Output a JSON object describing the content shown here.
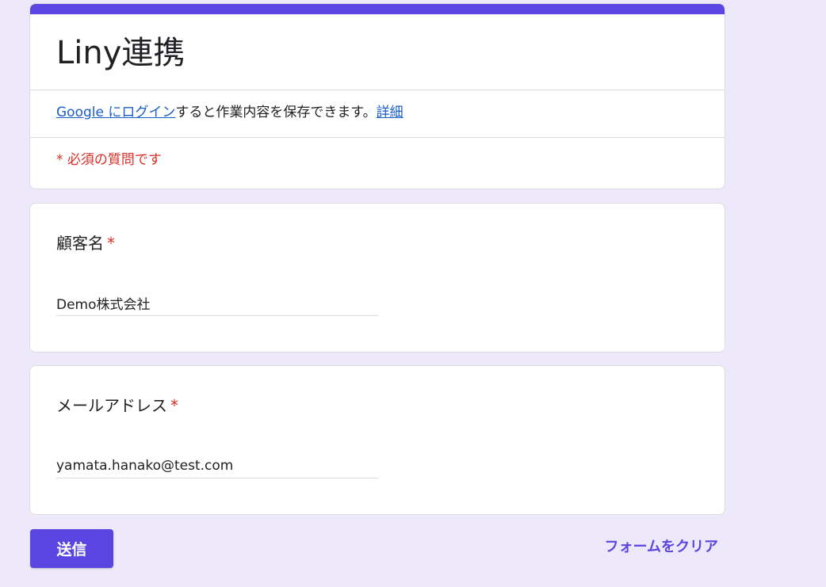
{
  "form": {
    "title": "Liny連携",
    "login_link": "Google にログイン",
    "login_text": "すると作業内容を保存できます。",
    "details_link": "詳細",
    "required_note": "* 必須の質問です"
  },
  "questions": [
    {
      "label": "顧客名",
      "required_mark": "*",
      "value": "Demo株式会社"
    },
    {
      "label": "メールアドレス",
      "required_mark": "*",
      "value": "yamata.hanako@test.com"
    }
  ],
  "actions": {
    "submit_label": "送信",
    "clear_label": "フォームをクリア"
  },
  "colors": {
    "accent": "#5b45e0",
    "background": "#ede9fa",
    "required": "#d93025",
    "link": "#1a5dc8"
  }
}
